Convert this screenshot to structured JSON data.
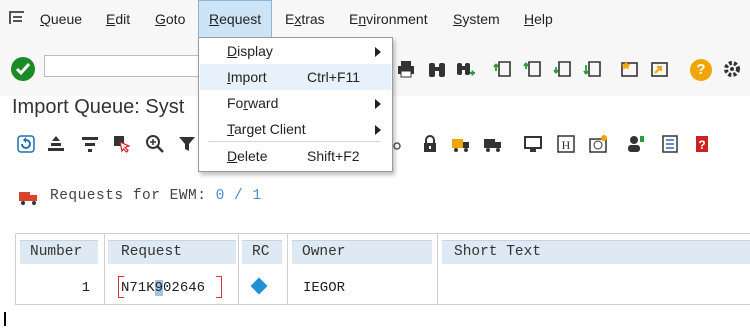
{
  "menubar": {
    "items": [
      "Queue",
      "Edit",
      "Goto",
      "Request",
      "Extras",
      "Environment",
      "System",
      "Help"
    ],
    "active_index": 3
  },
  "title": "Import Queue: Syst",
  "request_menu": {
    "items": [
      {
        "label": "Display",
        "shortcut": "",
        "submenu": true
      },
      {
        "label": "Import",
        "shortcut": "Ctrl+F11",
        "submenu": false
      },
      {
        "label": "Forward",
        "shortcut": "",
        "submenu": true
      },
      {
        "label": "Target Client",
        "shortcut": "",
        "submenu": true
      },
      {
        "label": "Delete",
        "shortcut": "Shift+F2",
        "submenu": false
      }
    ],
    "highlighted_index": 1
  },
  "requests_line": {
    "label": "Requests for EWM:",
    "count": "0 / 1"
  },
  "table": {
    "headers": [
      "Number",
      "Request",
      "RC",
      "Owner",
      "Short Text"
    ],
    "rows": [
      {
        "number": "1",
        "request": "N71K902646",
        "rc_icon": "blue-diamond-icon",
        "owner": "IEGOR",
        "short_text": ""
      }
    ]
  },
  "colors": {
    "ok_button": "#1b8b27",
    "help_button": "#f0a500",
    "active_menu_bg": "#cde4f7",
    "header_bg": "#dfe9f3",
    "rc_diamond": "#1e90d6"
  }
}
